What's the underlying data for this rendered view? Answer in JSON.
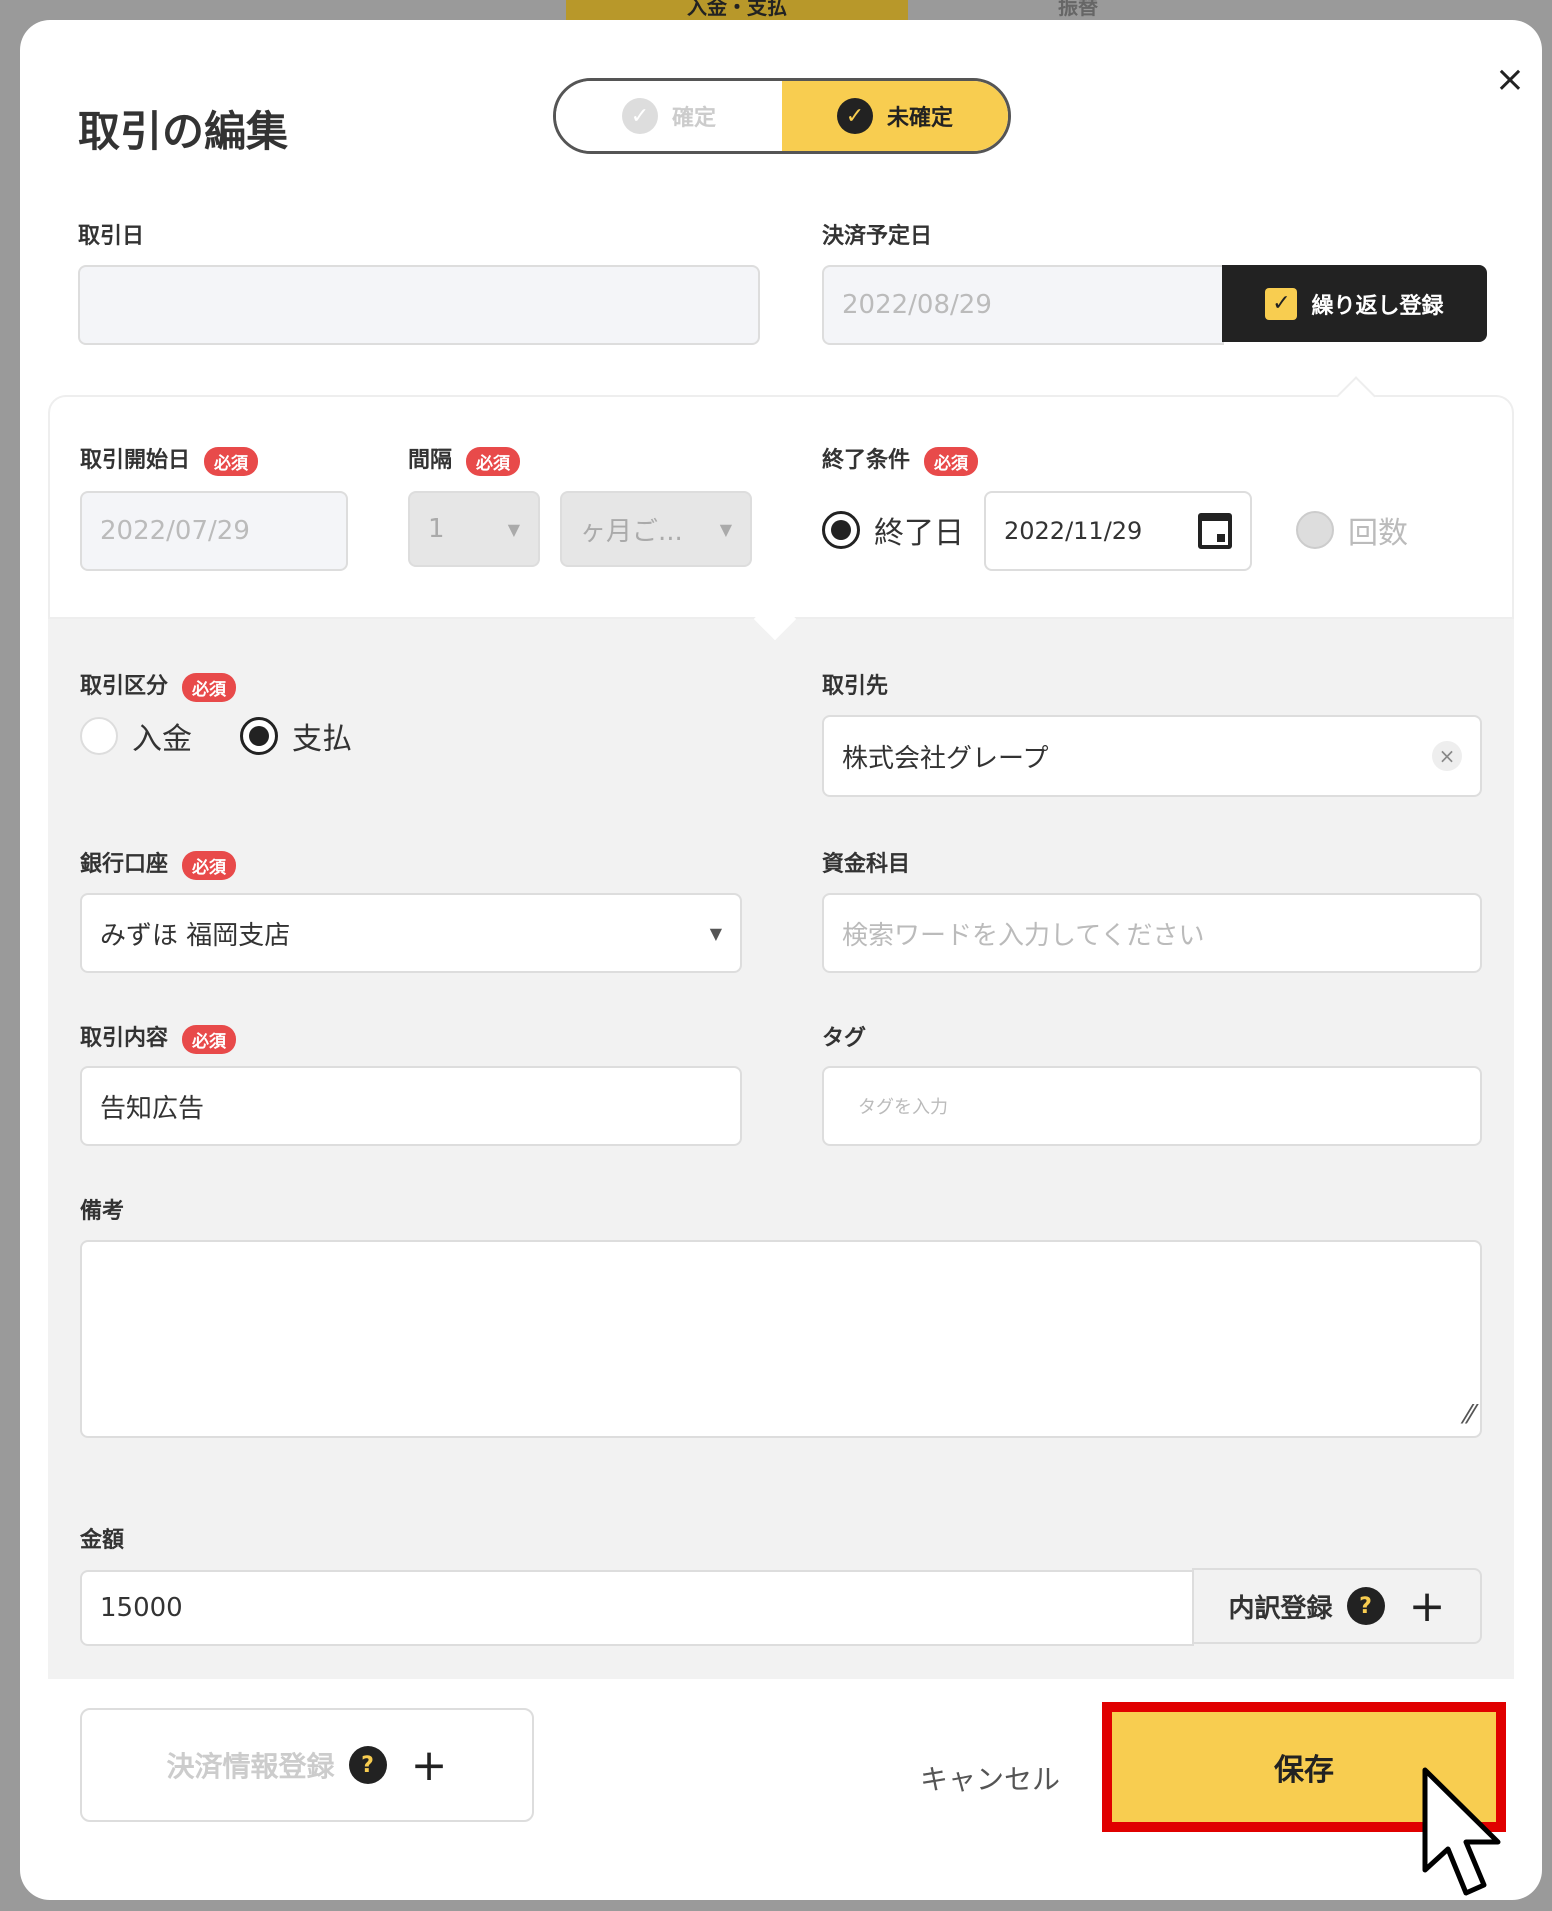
{
  "background": {
    "tab_active": "入金・支払",
    "tab_inactive": "振替"
  },
  "modal": {
    "title": "取引の編集",
    "close": "×"
  },
  "status_toggle": {
    "confirmed": "確定",
    "unconfirmed": "未確定",
    "selected": "unconfirmed"
  },
  "transaction_date": {
    "label": "取引日",
    "value": ""
  },
  "settlement_date": {
    "label": "決済予定日",
    "value": "2022/08/29"
  },
  "repeat_register": {
    "label": "繰り返し登録",
    "checked": true
  },
  "repeat": {
    "required_badge": "必須",
    "start_label": "取引開始日",
    "start_value": "2022/07/29",
    "interval_label": "間隔",
    "interval_value": "1",
    "interval_unit": "ヶ月ご...",
    "end_label": "終了条件",
    "end_date_option": "終了日",
    "end_date_value": "2022/11/29",
    "count_option": "回数"
  },
  "type": {
    "label": "取引区分",
    "required_badge": "必須",
    "deposit": "入金",
    "payment": "支払",
    "selected": "payment"
  },
  "partner": {
    "label": "取引先",
    "value": "株式会社グレープ"
  },
  "bank": {
    "label": "銀行口座",
    "required_badge": "必須",
    "value": "みずほ 福岡支店"
  },
  "fund_item": {
    "label": "資金科目",
    "placeholder": "検索ワードを入力してください"
  },
  "content": {
    "label": "取引内容",
    "required_badge": "必須",
    "value": "告知広告"
  },
  "tag": {
    "label": "タグ",
    "placeholder": "タグを入力"
  },
  "note": {
    "label": "備考",
    "value": ""
  },
  "amount": {
    "label": "金額",
    "value": "15000",
    "breakdown_label": "内訳登録"
  },
  "footer": {
    "settlement_info_label": "決済情報登録",
    "cancel_label": "キャンセル",
    "save_label": "保存"
  },
  "icons": {
    "help": "?",
    "plus": "+",
    "check": "✓",
    "caret": "▼",
    "clear": "×",
    "resize": "⁄⁄"
  },
  "colors": {
    "accent": "#f8cd50",
    "dark": "#222222",
    "required": "#e84a4a",
    "highlight": "#e00000"
  }
}
